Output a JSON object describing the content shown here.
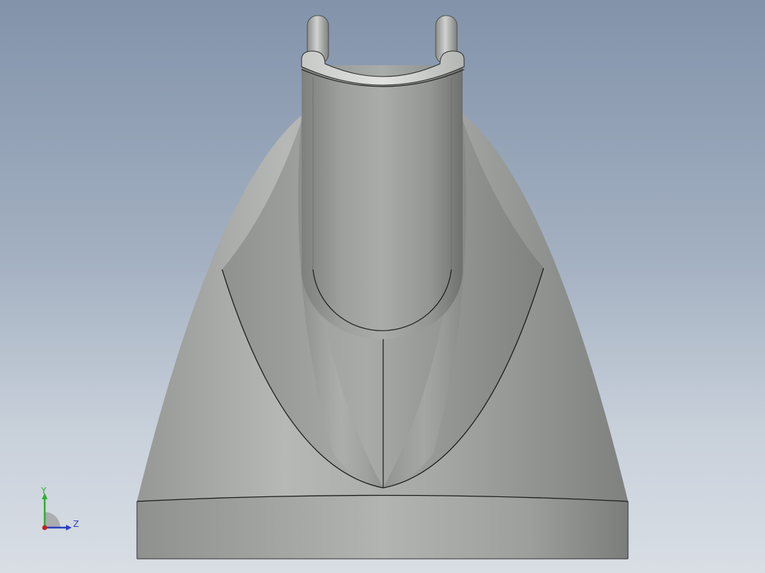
{
  "viewport": {
    "background_top": "#8293aa",
    "background_bottom": "#d9dee5",
    "model_color": "#a4a7a4",
    "edge_color": "#1b1b1b"
  },
  "triad": {
    "y_label": "Y",
    "z_label": "Z",
    "y_color": "#2fae2f",
    "z_color": "#2b3fbf",
    "origin_color": "#c0241c"
  }
}
